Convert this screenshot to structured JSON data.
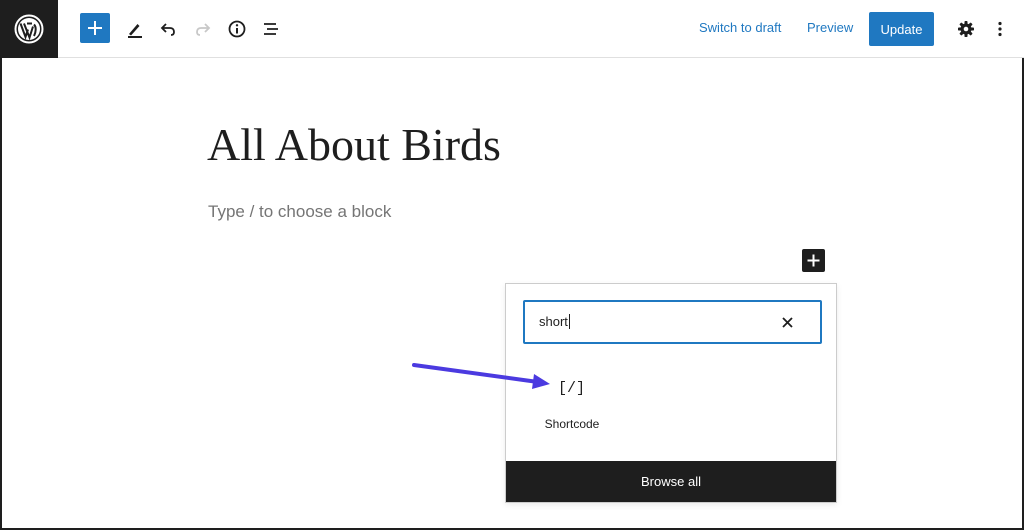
{
  "toolbar": {
    "switch_to_draft": "Switch to draft",
    "preview": "Preview",
    "update": "Update",
    "icons": [
      "wordpress-logo",
      "plus-icon",
      "pencil-icon",
      "undo-icon",
      "redo-icon",
      "info-icon",
      "list-view-icon",
      "settings-icon",
      "more-options-icon"
    ]
  },
  "editor": {
    "title": "All About Birds",
    "block_placeholder": "Type / to choose a block"
  },
  "inserter": {
    "search_value": "short",
    "results": [
      {
        "icon": "[/]",
        "label": "Shortcode"
      }
    ],
    "browse_all": "Browse all"
  },
  "colors": {
    "accent": "#1f78c1",
    "dark": "#1e1e1e",
    "annotation_arrow": "#4b3ae0"
  }
}
